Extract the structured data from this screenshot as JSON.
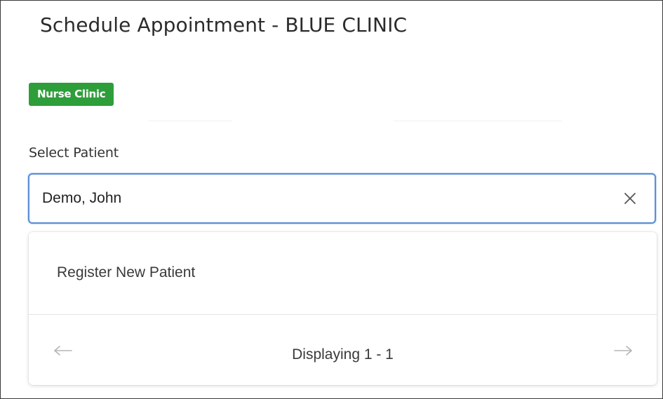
{
  "header": {
    "title": "Schedule Appointment - BLUE CLINIC"
  },
  "badge": {
    "label": "Nurse Clinic",
    "color": "#2e9e3a"
  },
  "patient_field": {
    "label": "Select Patient",
    "value": "Demo, John",
    "clear_icon": "close-icon",
    "focus_color": "#5b8ed6"
  },
  "dropdown": {
    "items": [
      {
        "label": "Register New Patient"
      }
    ],
    "pager": {
      "prev_icon": "arrow-left-icon",
      "next_icon": "arrow-right-icon",
      "status": "Displaying 1 - 1"
    }
  }
}
